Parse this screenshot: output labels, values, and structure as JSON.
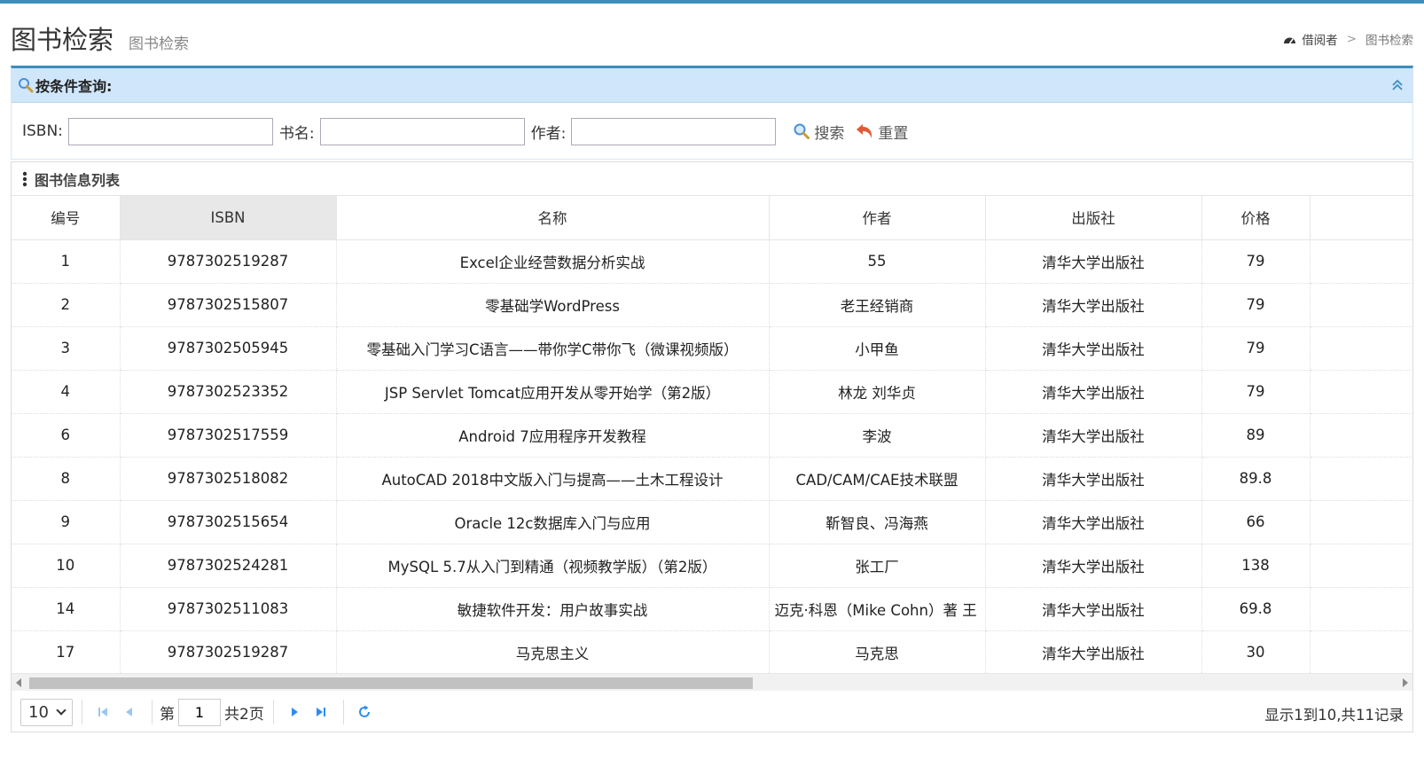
{
  "header": {
    "title": "图书检索",
    "subtitle": "图书检索",
    "breadcrumb": {
      "home": "借阅者",
      "separator": ">",
      "current": "图书检索"
    }
  },
  "search": {
    "panel_title": "按条件查询:",
    "isbn_label": "ISBN:",
    "name_label": "书名:",
    "author_label": "作者:",
    "isbn_value": "",
    "name_value": "",
    "author_value": "",
    "search_label": "搜索",
    "reset_label": "重置"
  },
  "list": {
    "panel_title": "图书信息列表",
    "columns": [
      "编号",
      "ISBN",
      "名称",
      "作者",
      "出版社",
      "价格"
    ],
    "rows": [
      [
        "1",
        "9787302519287",
        "Excel企业经营数据分析实战",
        "55",
        "清华大学出版社",
        "79"
      ],
      [
        "2",
        "9787302515807",
        "零基础学WordPress",
        "老王经销商",
        "清华大学出版社",
        "79"
      ],
      [
        "3",
        "9787302505945",
        "零基础入门学习C语言——带你学C带你飞（微课视频版）",
        "小甲鱼",
        "清华大学出版社",
        "79"
      ],
      [
        "4",
        "9787302523352",
        "JSP Servlet Tomcat应用开发从零开始学（第2版）",
        "林龙 刘华贞",
        "清华大学出版社",
        "79"
      ],
      [
        "6",
        "9787302517559",
        "Android 7应用程序开发教程",
        "李波",
        "清华大学出版社",
        "89"
      ],
      [
        "8",
        "9787302518082",
        "AutoCAD 2018中文版入门与提高——土木工程设计",
        "CAD/CAM/CAE技术联盟",
        "清华大学出版社",
        "89.8"
      ],
      [
        "9",
        "9787302515654",
        "Oracle 12c数据库入门与应用",
        "靳智良、冯海燕",
        "清华大学出版社",
        "66"
      ],
      [
        "10",
        "9787302524281",
        "MySQL 5.7从入门到精通（视频教学版）（第2版）",
        "张工厂",
        "清华大学出版社",
        "138"
      ],
      [
        "14",
        "9787302511083",
        "敏捷软件开发：用户故事实战",
        "迈克·科恩（Mike Cohn）著 王",
        "清华大学出版社",
        "69.8"
      ],
      [
        "17",
        "9787302519287",
        "马克思主义",
        "马克思",
        "清华大学出版社",
        "30"
      ]
    ]
  },
  "pager": {
    "page_size": "10",
    "page_prefix": "第",
    "page_number": "1",
    "page_total": "共2页",
    "info": "显示1到10,共11记录"
  },
  "colors": {
    "accent": "#3c8dbc",
    "panel_head": "#cfe6fb",
    "icon_blue": "#2d8cf0"
  }
}
